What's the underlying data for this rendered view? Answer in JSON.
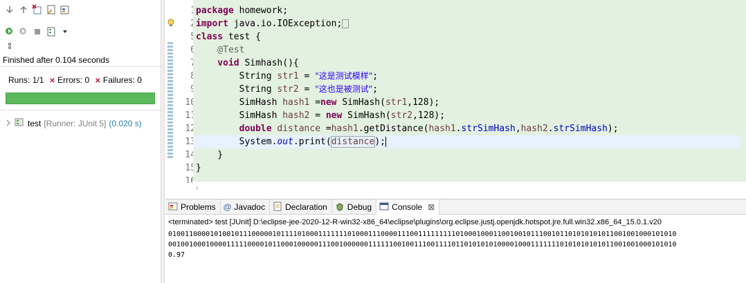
{
  "junit": {
    "status": "Finished after 0.104 seconds",
    "runs_label": "Runs:",
    "runs_value": "1/1",
    "errors_label": "Errors:",
    "errors_value": "0",
    "failures_label": "Failures:",
    "failures_value": "0",
    "progress_fraction": 1.0,
    "progress_color": "#5cb85c",
    "tree": {
      "name": "test",
      "runner": "[Runner: JUnit 5]",
      "time": "(0.020 s)"
    }
  },
  "editor": {
    "line_numbers": [
      "1",
      "2",
      "5",
      "6",
      "7",
      "8",
      "9",
      "10",
      "11",
      "12",
      "13",
      "14",
      "15",
      "16"
    ],
    "lines": {
      "l1_kw": "package",
      "l1_rest": " homework;",
      "l2_kw": "import",
      "l2_rest": " java.io.IOException;",
      "l5_kw": "class",
      "l5_rest": " test {",
      "l6_ann": "    @Test",
      "l7_kw": "    void",
      "l7_rest": " Simhash(){",
      "l8_type": "        String ",
      "l8_var": "str1",
      "l8_eq": " = ",
      "l8_str": "\"这是测试模样\"",
      "l8_end": ";",
      "l9_type": "        String ",
      "l9_var": "str2",
      "l9_eq": " = ",
      "l9_str": "\"这也是被测试\"",
      "l9_end": ";",
      "l10_type": "        SimHash ",
      "l10_var": "hash1",
      "l10_eq": " =",
      "l10_new": "new",
      "l10_rest1": " SimHash(",
      "l10_arg": "str1",
      "l10_rest2": ",128);",
      "l11_type": "        SimHash ",
      "l11_var": "hash2",
      "l11_eq": " = ",
      "l11_new": "new",
      "l11_rest1": " SimHash(",
      "l11_arg": "str2",
      "l11_rest2": ",128);",
      "l12_kw": "        double",
      "l12_sp": " ",
      "l12_var": "distance",
      "l12_eq": " =",
      "l12_h1": "hash1",
      "l12_call": ".getDistance(",
      "l12_h1b": "hash1",
      "l12_dot1": ".",
      "l12_f1": "strSimHash",
      "l12_comma": ",",
      "l12_h2": "hash2",
      "l12_dot2": ".",
      "l12_f2": "strSimHash",
      "l12_end": ");",
      "l13_pre": "        System.",
      "l13_out": "out",
      "l13_mid": ".print(",
      "l13_var": "distance",
      "l13_end": ");",
      "l14": "    }",
      "l15": "}"
    }
  },
  "console": {
    "tabs": [
      {
        "label": "Problems",
        "icon": "problems-icon"
      },
      {
        "label": "Javadoc",
        "icon": "at-icon"
      },
      {
        "label": "Declaration",
        "icon": "declaration-icon"
      },
      {
        "label": "Debug",
        "icon": "debug-icon"
      },
      {
        "label": "Console",
        "icon": "console-icon"
      }
    ],
    "terminated": "<terminated> test [JUnit] D:\\eclipse-jee-2020-12-R-win32-x86_64\\eclipse\\plugins\\org.eclipse.justj.openjdk.hotspot.jre.full.win32.x86_64_15.0.1.v20",
    "out1": "01001100001010010111000001011110100011111110100011100001110011111111101000100011001001011100101101010101011001001000101010",
    "out2": "00100100010000111110000101100010000011100100000011111100100111001111011010101010000100011111110101010101011001001000101010",
    "out3": "0.97"
  }
}
